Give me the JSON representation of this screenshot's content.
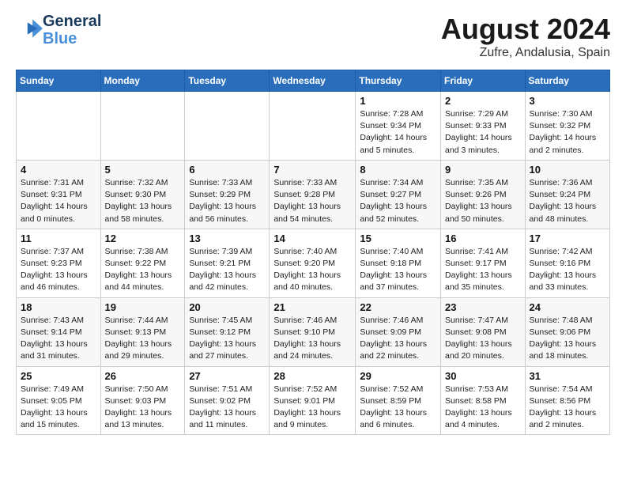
{
  "logo": {
    "line1": "General",
    "line2": "Blue"
  },
  "title": "August 2024",
  "subtitle": "Zufre, Andalusia, Spain",
  "weekdays": [
    "Sunday",
    "Monday",
    "Tuesday",
    "Wednesday",
    "Thursday",
    "Friday",
    "Saturday"
  ],
  "weeks": [
    [
      {
        "day": "",
        "info": ""
      },
      {
        "day": "",
        "info": ""
      },
      {
        "day": "",
        "info": ""
      },
      {
        "day": "",
        "info": ""
      },
      {
        "day": "1",
        "info": "Sunrise: 7:28 AM\nSunset: 9:34 PM\nDaylight: 14 hours\nand 5 minutes."
      },
      {
        "day": "2",
        "info": "Sunrise: 7:29 AM\nSunset: 9:33 PM\nDaylight: 14 hours\nand 3 minutes."
      },
      {
        "day": "3",
        "info": "Sunrise: 7:30 AM\nSunset: 9:32 PM\nDaylight: 14 hours\nand 2 minutes."
      }
    ],
    [
      {
        "day": "4",
        "info": "Sunrise: 7:31 AM\nSunset: 9:31 PM\nDaylight: 14 hours\nand 0 minutes."
      },
      {
        "day": "5",
        "info": "Sunrise: 7:32 AM\nSunset: 9:30 PM\nDaylight: 13 hours\nand 58 minutes."
      },
      {
        "day": "6",
        "info": "Sunrise: 7:33 AM\nSunset: 9:29 PM\nDaylight: 13 hours\nand 56 minutes."
      },
      {
        "day": "7",
        "info": "Sunrise: 7:33 AM\nSunset: 9:28 PM\nDaylight: 13 hours\nand 54 minutes."
      },
      {
        "day": "8",
        "info": "Sunrise: 7:34 AM\nSunset: 9:27 PM\nDaylight: 13 hours\nand 52 minutes."
      },
      {
        "day": "9",
        "info": "Sunrise: 7:35 AM\nSunset: 9:26 PM\nDaylight: 13 hours\nand 50 minutes."
      },
      {
        "day": "10",
        "info": "Sunrise: 7:36 AM\nSunset: 9:24 PM\nDaylight: 13 hours\nand 48 minutes."
      }
    ],
    [
      {
        "day": "11",
        "info": "Sunrise: 7:37 AM\nSunset: 9:23 PM\nDaylight: 13 hours\nand 46 minutes."
      },
      {
        "day": "12",
        "info": "Sunrise: 7:38 AM\nSunset: 9:22 PM\nDaylight: 13 hours\nand 44 minutes."
      },
      {
        "day": "13",
        "info": "Sunrise: 7:39 AM\nSunset: 9:21 PM\nDaylight: 13 hours\nand 42 minutes."
      },
      {
        "day": "14",
        "info": "Sunrise: 7:40 AM\nSunset: 9:20 PM\nDaylight: 13 hours\nand 40 minutes."
      },
      {
        "day": "15",
        "info": "Sunrise: 7:40 AM\nSunset: 9:18 PM\nDaylight: 13 hours\nand 37 minutes."
      },
      {
        "day": "16",
        "info": "Sunrise: 7:41 AM\nSunset: 9:17 PM\nDaylight: 13 hours\nand 35 minutes."
      },
      {
        "day": "17",
        "info": "Sunrise: 7:42 AM\nSunset: 9:16 PM\nDaylight: 13 hours\nand 33 minutes."
      }
    ],
    [
      {
        "day": "18",
        "info": "Sunrise: 7:43 AM\nSunset: 9:14 PM\nDaylight: 13 hours\nand 31 minutes."
      },
      {
        "day": "19",
        "info": "Sunrise: 7:44 AM\nSunset: 9:13 PM\nDaylight: 13 hours\nand 29 minutes."
      },
      {
        "day": "20",
        "info": "Sunrise: 7:45 AM\nSunset: 9:12 PM\nDaylight: 13 hours\nand 27 minutes."
      },
      {
        "day": "21",
        "info": "Sunrise: 7:46 AM\nSunset: 9:10 PM\nDaylight: 13 hours\nand 24 minutes."
      },
      {
        "day": "22",
        "info": "Sunrise: 7:46 AM\nSunset: 9:09 PM\nDaylight: 13 hours\nand 22 minutes."
      },
      {
        "day": "23",
        "info": "Sunrise: 7:47 AM\nSunset: 9:08 PM\nDaylight: 13 hours\nand 20 minutes."
      },
      {
        "day": "24",
        "info": "Sunrise: 7:48 AM\nSunset: 9:06 PM\nDaylight: 13 hours\nand 18 minutes."
      }
    ],
    [
      {
        "day": "25",
        "info": "Sunrise: 7:49 AM\nSunset: 9:05 PM\nDaylight: 13 hours\nand 15 minutes."
      },
      {
        "day": "26",
        "info": "Sunrise: 7:50 AM\nSunset: 9:03 PM\nDaylight: 13 hours\nand 13 minutes."
      },
      {
        "day": "27",
        "info": "Sunrise: 7:51 AM\nSunset: 9:02 PM\nDaylight: 13 hours\nand 11 minutes."
      },
      {
        "day": "28",
        "info": "Sunrise: 7:52 AM\nSunset: 9:01 PM\nDaylight: 13 hours\nand 9 minutes."
      },
      {
        "day": "29",
        "info": "Sunrise: 7:52 AM\nSunset: 8:59 PM\nDaylight: 13 hours\nand 6 minutes."
      },
      {
        "day": "30",
        "info": "Sunrise: 7:53 AM\nSunset: 8:58 PM\nDaylight: 13 hours\nand 4 minutes."
      },
      {
        "day": "31",
        "info": "Sunrise: 7:54 AM\nSunset: 8:56 PM\nDaylight: 13 hours\nand 2 minutes."
      }
    ]
  ]
}
